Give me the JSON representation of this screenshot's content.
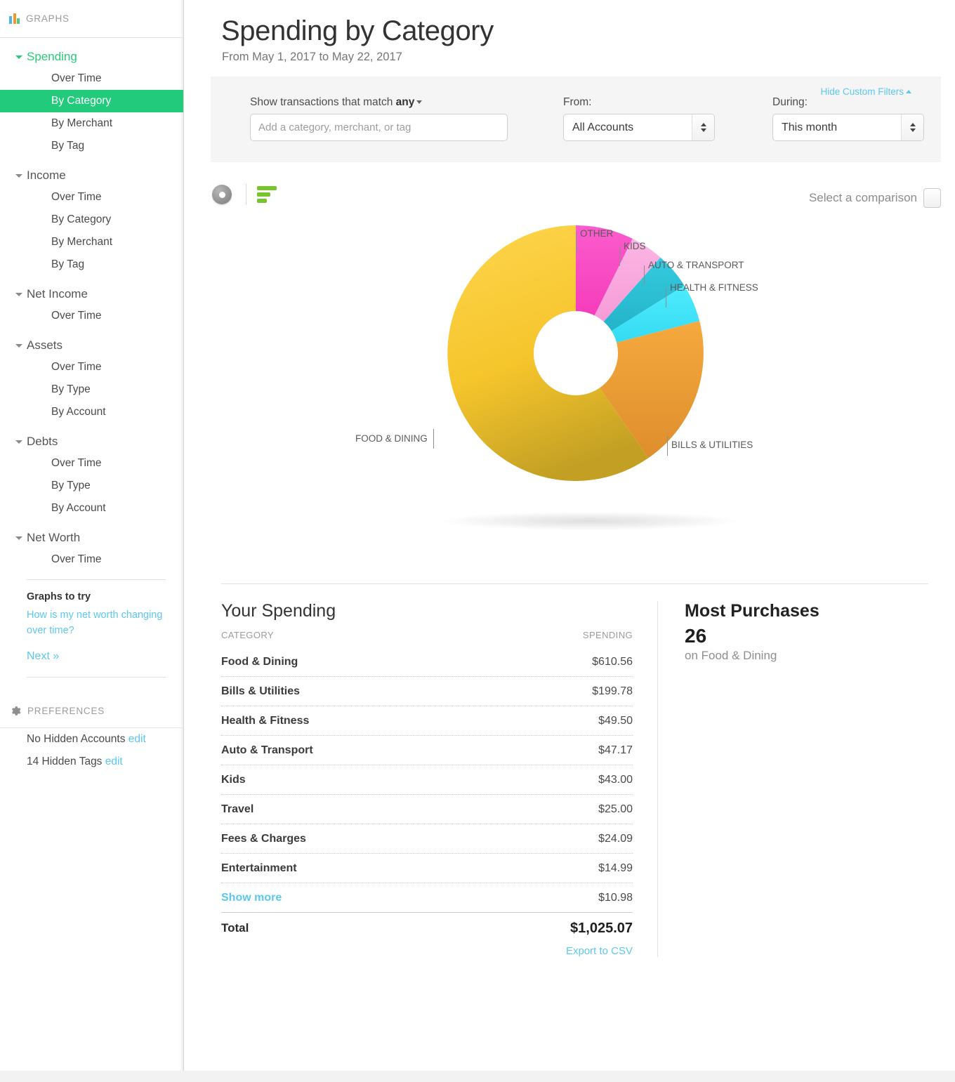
{
  "sidebar": {
    "graphs_header": "GRAPHS",
    "groups": [
      {
        "label": "Spending",
        "active": true,
        "items": [
          "Over Time",
          "By Category",
          "By Merchant",
          "By Tag"
        ],
        "selected": "By Category"
      },
      {
        "label": "Income",
        "active": false,
        "items": [
          "Over Time",
          "By Category",
          "By Merchant",
          "By Tag"
        ]
      },
      {
        "label": "Net Income",
        "active": false,
        "items": [
          "Over Time"
        ]
      },
      {
        "label": "Assets",
        "active": false,
        "items": [
          "Over Time",
          "By Type",
          "By Account"
        ]
      },
      {
        "label": "Debts",
        "active": false,
        "items": [
          "Over Time",
          "By Type",
          "By Account"
        ]
      },
      {
        "label": "Net Worth",
        "active": false,
        "items": [
          "Over Time"
        ]
      }
    ],
    "graphs_to_try": {
      "title": "Graphs to try",
      "link": "How is my net worth changing over time?",
      "next": "Next »"
    },
    "preferences_header": "PREFERENCES",
    "pref_rows": [
      {
        "text": "No Hidden Accounts",
        "edit": "edit"
      },
      {
        "text": "14 Hidden Tags",
        "edit": "edit"
      }
    ]
  },
  "header": {
    "title": "Spending by Category",
    "subtitle": "From May 1, 2017 to May 22, 2017"
  },
  "filters": {
    "hide_custom_filters": "Hide Custom Filters",
    "match_label_prefix": "Show transactions that match",
    "match_value": "any",
    "search_placeholder": "Add a category, merchant, or tag",
    "search_value": "",
    "from_label": "From:",
    "from_value": "All Accounts",
    "during_label": "During:",
    "during_value": "This month"
  },
  "toolbar": {
    "donut_icon": "donut-chart-icon",
    "bars_icon": "bar-chart-icon",
    "comparison_label": "Select a comparison"
  },
  "chart_data": {
    "type": "pie",
    "title": "Spending by Category",
    "donut": true,
    "start_angle": 0,
    "labels_uppercase": true,
    "total": 1025.07,
    "categories": [
      "OTHER",
      "KIDS",
      "AUTO & TRANSPORT",
      "HEALTH & FITNESS",
      "BILLS & UTILITIES",
      "FOOD & DINING"
    ],
    "values": [
      75.06,
      43.0,
      47.17,
      49.5,
      199.78,
      610.56
    ],
    "colors": [
      "#F845C0",
      "#F9A3DC",
      "#29BDD3",
      "#3FE3F8",
      "#F0A03A",
      "#FCC92F"
    ],
    "percent": [
      7.3,
      4.2,
      4.6,
      4.8,
      19.5,
      59.6
    ],
    "legend": "callout-labels"
  },
  "spending_table": {
    "heading": "Your Spending",
    "col_category": "CATEGORY",
    "col_spending": "SPENDING",
    "rows": [
      {
        "category": "Food & Dining",
        "amount": "$610.56"
      },
      {
        "category": "Bills & Utilities",
        "amount": "$199.78"
      },
      {
        "category": "Health & Fitness",
        "amount": "$49.50"
      },
      {
        "category": "Auto & Transport",
        "amount": "$47.17"
      },
      {
        "category": "Kids",
        "amount": "$43.00"
      },
      {
        "category": "Travel",
        "amount": "$25.00"
      },
      {
        "category": "Fees & Charges",
        "amount": "$24.09"
      },
      {
        "category": "Entertainment",
        "amount": "$14.99"
      }
    ],
    "show_more": "Show more",
    "show_more_amount": "$10.98",
    "total_label": "Total",
    "total_amount": "$1,025.07",
    "export": "Export to CSV"
  },
  "most_purchases": {
    "heading": "Most Purchases",
    "value": "26",
    "subtitle": "on Food & Dining"
  }
}
